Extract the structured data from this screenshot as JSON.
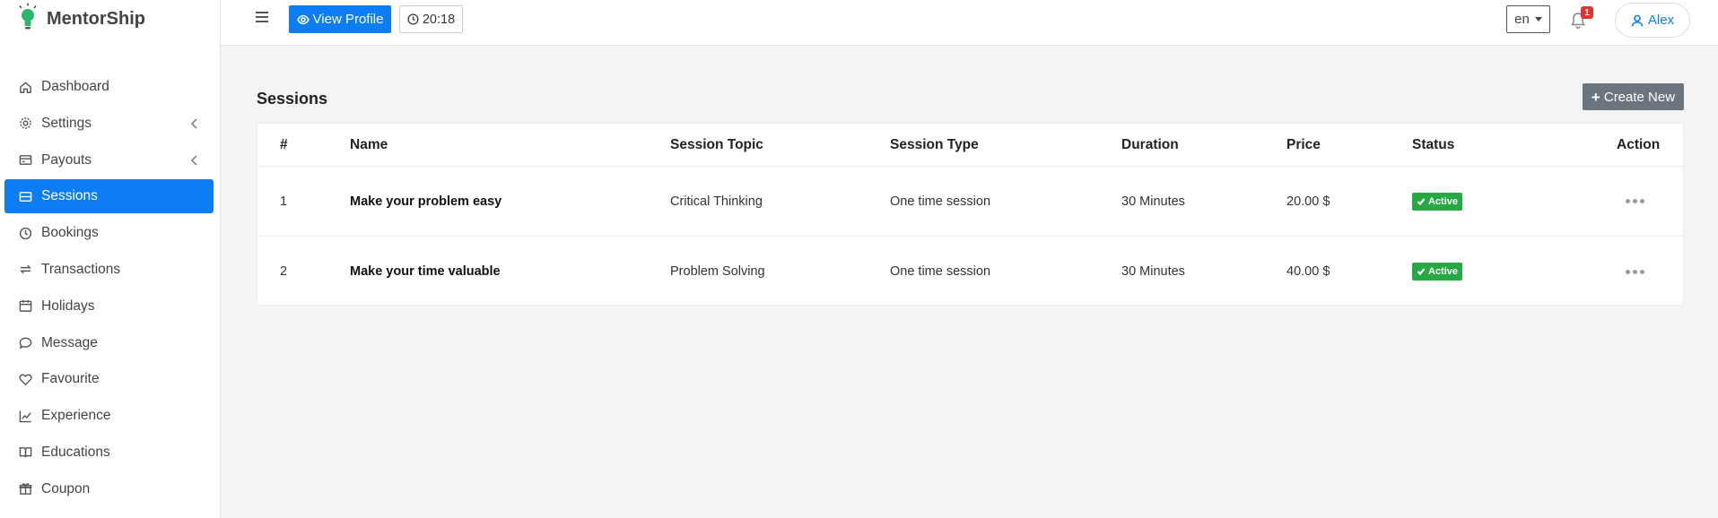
{
  "brand": {
    "name": "MentorShip"
  },
  "sidebar": {
    "items": [
      {
        "label": "Dashboard",
        "icon": "home-icon"
      },
      {
        "label": "Settings",
        "icon": "gear-icon"
      },
      {
        "label": "Payouts",
        "icon": "card-icon"
      },
      {
        "label": "Sessions",
        "icon": "sessions-icon"
      },
      {
        "label": "Bookings",
        "icon": "clock-icon"
      },
      {
        "label": "Transactions",
        "icon": "repeat-icon"
      },
      {
        "label": "Holidays",
        "icon": "calendar-icon"
      },
      {
        "label": "Message",
        "icon": "chat-icon"
      },
      {
        "label": "Favourite",
        "icon": "heart-icon"
      },
      {
        "label": "Experience",
        "icon": "chart-line-icon"
      },
      {
        "label": "Educations",
        "icon": "book-icon"
      },
      {
        "label": "Coupon",
        "icon": "gift-icon"
      }
    ],
    "active": "Sessions"
  },
  "topbar": {
    "view_profile_label": "View Profile",
    "time": "20:18",
    "language": "en",
    "notification_count": "1",
    "user_name": "Alex"
  },
  "page": {
    "title": "Sessions",
    "create_label": "Create New"
  },
  "table": {
    "headers": {
      "num": "#",
      "name": "Name",
      "topic": "Session Topic",
      "type": "Session Type",
      "duration": "Duration",
      "price": "Price",
      "status": "Status",
      "action": "Action"
    },
    "rows": [
      {
        "num": "1",
        "name": "Make your problem easy",
        "topic": "Critical Thinking",
        "type": "One time session",
        "duration": "30 Minutes",
        "price": "20.00 $",
        "status": "Active"
      },
      {
        "num": "2",
        "name": "Make your time valuable",
        "topic": "Problem Solving",
        "type": "One time session",
        "duration": "30 Minutes",
        "price": "40.00 $",
        "status": "Active"
      }
    ]
  },
  "colors": {
    "primary": "#0d7df3",
    "success": "#28a745",
    "secondary": "#6c757d",
    "danger": "#e3342f"
  }
}
